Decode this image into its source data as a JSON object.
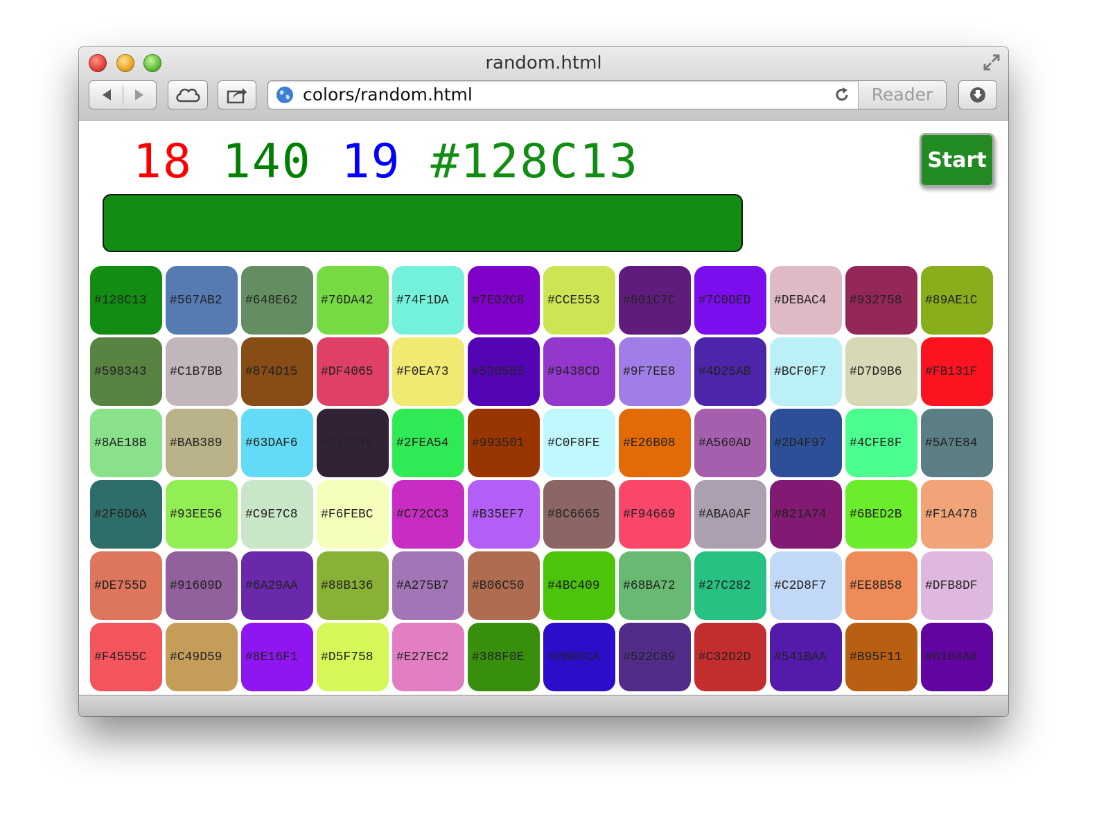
{
  "window": {
    "title": "random.html"
  },
  "toolbar": {
    "url": "colors/random.html",
    "reader_label": "Reader"
  },
  "page": {
    "red": "18",
    "green": "140",
    "blue": "19",
    "hex": "#128C13",
    "current_color": "#128C13",
    "start_label": "Start",
    "colors": {
      "red_text": "#ff0000",
      "green_text": "#008000",
      "blue_text": "#0000ff",
      "start_bg": "#228b22"
    }
  },
  "swatches": [
    "#128C13",
    "#567AB2",
    "#648E62",
    "#76DA42",
    "#74F1DA",
    "#7E02C8",
    "#CCE553",
    "#601C7C",
    "#7C0DED",
    "#DEBAC4",
    "#932758",
    "#89AE1C",
    "#598343",
    "#C1B7BB",
    "#874D15",
    "#DF4065",
    "#F0EA73",
    "#5305B5",
    "#9438CD",
    "#9F7EE8",
    "#4D25AB",
    "#BCF0F7",
    "#D7D9B6",
    "#FB131F",
    "#8AE18B",
    "#BAB389",
    "#63DAF6",
    "#312236",
    "#2FEA54",
    "#993501",
    "#C0F8FE",
    "#E26B08",
    "#A560AD",
    "#2D4F97",
    "#4CFE8F",
    "#5A7E84",
    "#2F6D6A",
    "#93EE56",
    "#C9E7C8",
    "#F6FEBC",
    "#C72CC3",
    "#B35EF7",
    "#8C6665",
    "#F94669",
    "#ABA0AF",
    "#821A74",
    "#6BED2B",
    "#F1A478",
    "#DE755D",
    "#91609D",
    "#6A29AA",
    "#88B136",
    "#A275B7",
    "#B06C50",
    "#4BC409",
    "#68BA72",
    "#27C282",
    "#C2D8F7",
    "#EE8B58",
    "#DFB8DF",
    "#F4555C",
    "#C49D59",
    "#8E16F1",
    "#D5F758",
    "#E27EC2",
    "#388F0E",
    "#2B0DCA",
    "#522C89",
    "#C32D2D",
    "#541BAA",
    "#B95F11",
    "#6104A0"
  ]
}
